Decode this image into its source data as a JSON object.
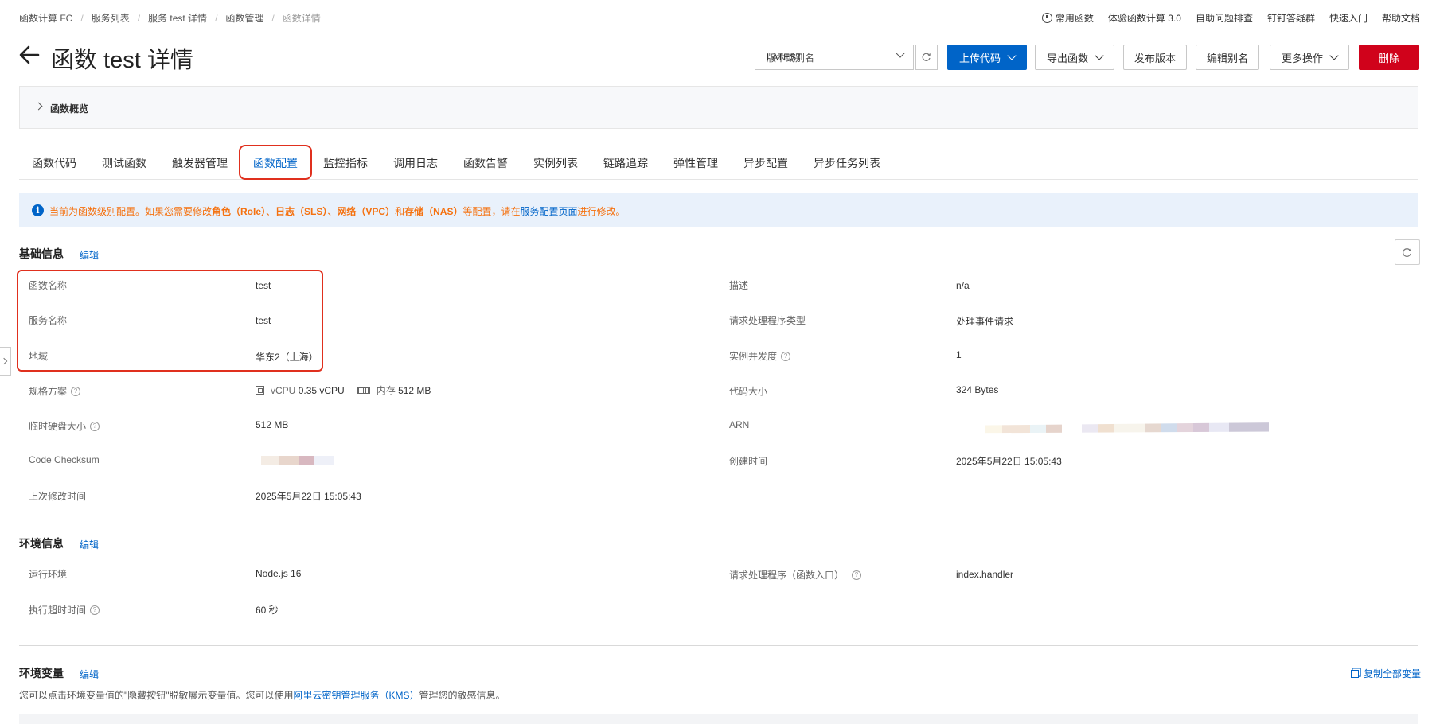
{
  "breadcrumb": [
    "函数计算 FC",
    "服务列表",
    "服务 test 详情",
    "函数管理",
    "函数详情"
  ],
  "top_links": [
    "常用函数",
    "体验函数计算 3.0",
    "自助问题排查",
    "钉钉答疑群",
    "快速入门",
    "帮助文档"
  ],
  "page_title": "函数 test 详情",
  "version_select": {
    "label": "版本或别名",
    "value": "LATEST"
  },
  "actions": {
    "upload": "上传代码",
    "export": "导出函数",
    "publish": "发布版本",
    "edit_alias": "编辑别名",
    "more": "更多操作",
    "delete": "删除"
  },
  "overview_label": "函数概览",
  "tabs": [
    "函数代码",
    "测试函数",
    "触发器管理",
    "函数配置",
    "监控指标",
    "调用日志",
    "函数告警",
    "实例列表",
    "链路追踪",
    "弹性管理",
    "异步配置",
    "异步任务列表"
  ],
  "active_tab": "函数配置",
  "banner": {
    "t1": "当前为函数级别配置。如果您需要修改",
    "b1": "角色（Role）",
    "t2": "、",
    "b2": "日志（SLS）",
    "t3": "、",
    "b3": "网络（VPC）",
    "t4": "和",
    "b4": "存储（NAS）",
    "t5": "等配置，请在",
    "link": "服务配置页面",
    "t6": "进行修改。"
  },
  "basic": {
    "title": "基础信息",
    "edit": "编辑",
    "fn_name_label": "函数名称",
    "fn_name": "test",
    "svc_name_label": "服务名称",
    "svc_name": "test",
    "region_label": "地域",
    "region": "华东2（上海）",
    "spec_label": "规格方案",
    "vcpu_label": "vCPU",
    "vcpu": "0.35 vCPU",
    "mem_label": "内存",
    "mem": "512 MB",
    "disk_label": "临时硬盘大小",
    "disk": "512 MB",
    "checksum_label": "Code Checksum",
    "modified_label": "上次修改时间",
    "modified": "2025年5月22日 15:05:43",
    "desc_label": "描述",
    "desc": "n/a",
    "handler_type_label": "请求处理程序类型",
    "handler_type": "处理事件请求",
    "concurrency_label": "实例并发度",
    "concurrency": "1",
    "code_size_label": "代码大小",
    "code_size": "324 Bytes",
    "arn_label": "ARN",
    "created_label": "创建时间",
    "created": "2025年5月22日 15:05:43"
  },
  "env": {
    "title": "环境信息",
    "edit": "编辑",
    "runtime_label": "运行环境",
    "runtime": "Node.js 16",
    "timeout_label": "执行超时时间",
    "timeout": "60 秒",
    "handler_label": "请求处理程序（函数入口）",
    "handler": "index.handler"
  },
  "envvars": {
    "title": "环境变量",
    "edit": "编辑",
    "copy_all": "复制全部变量",
    "desc1": "您可以点击环境变量值的\"隐藏按钮\"脱敏展示变量值。您可以使用",
    "link": "阿里云密钥管理服务（KMS）",
    "desc2": "管理您的敏感信息。"
  },
  "colors": {
    "primary": "#0064c8",
    "danger": "#d0021b",
    "warning": "#f5710f",
    "highlight": "#e0301e"
  }
}
